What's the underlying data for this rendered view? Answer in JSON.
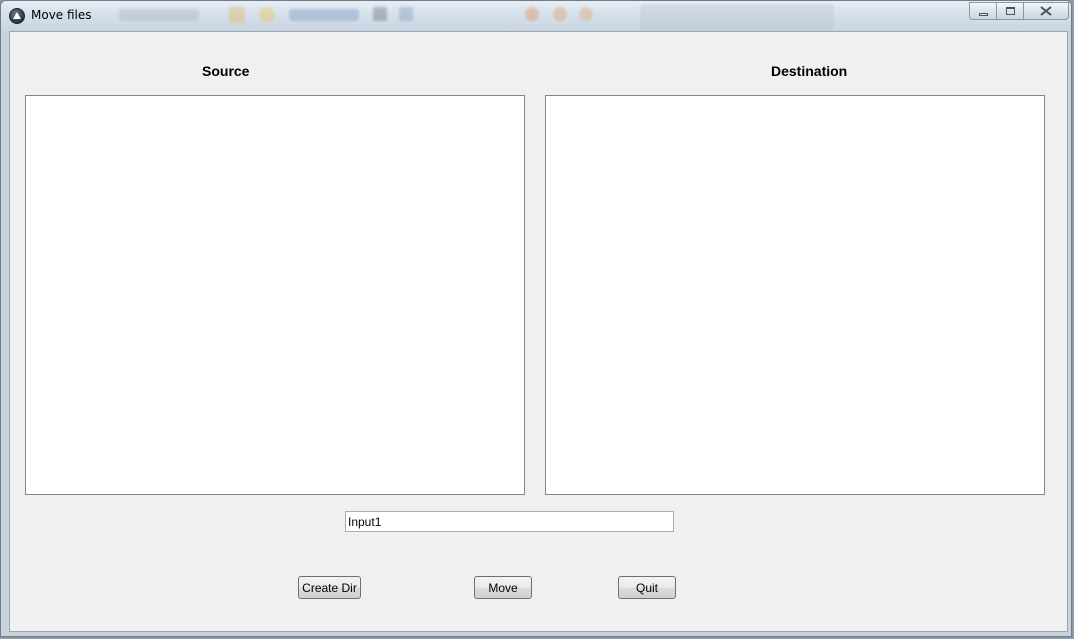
{
  "window": {
    "title": "Move files",
    "caption_buttons": {
      "minimize": "minimize-icon",
      "maximize": "maximize-icon",
      "close": "close-icon"
    }
  },
  "panels": {
    "source_label": "Source",
    "destination_label": "Destination"
  },
  "input": {
    "value": "Input1"
  },
  "buttons": {
    "create_dir": "Create Dir",
    "move": "Move",
    "quit": "Quit"
  }
}
